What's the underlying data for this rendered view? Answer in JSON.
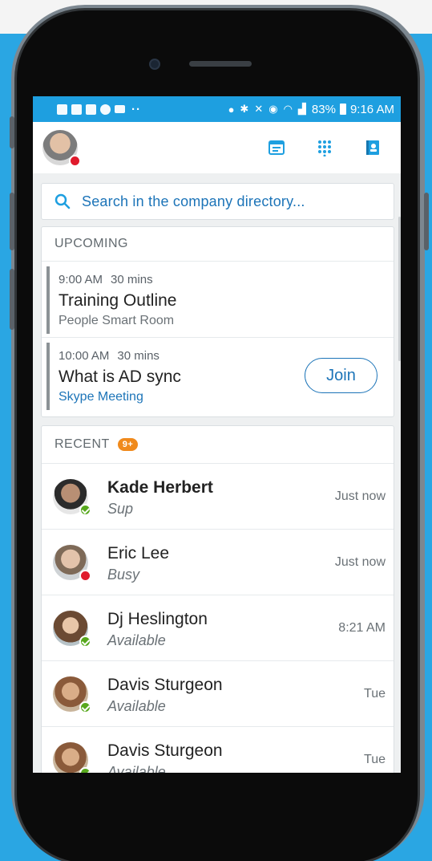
{
  "statusbar": {
    "dots": "··",
    "battery": "83%",
    "time": "9:16 AM"
  },
  "search": {
    "placeholder": "Search in the company directory..."
  },
  "upcoming": {
    "heading": "UPCOMING",
    "events": [
      {
        "time": "9:00 AM",
        "duration": "30 mins",
        "title": "Training Outline",
        "location": "People Smart Room"
      },
      {
        "time": "10:00 AM",
        "duration": "30 mins",
        "title": "What is AD sync",
        "location": "Skype Meeting",
        "join_label": "Join"
      }
    ]
  },
  "recent": {
    "heading": "RECENT",
    "badge": "9+",
    "contacts": [
      {
        "name": "Kade Herbert",
        "status": "Sup",
        "time": "Just now",
        "presence": "available"
      },
      {
        "name": "Eric Lee",
        "status": "Busy",
        "time": "Just now",
        "presence": "busy"
      },
      {
        "name": "Dj Heslington",
        "status": "Available",
        "time": "8:21 AM",
        "presence": "available"
      },
      {
        "name": "Davis Sturgeon",
        "status": "Available",
        "time": "Tue",
        "presence": "available"
      },
      {
        "name": "Davis Sturgeon",
        "status": "Available",
        "time": "Tue",
        "presence": "available"
      }
    ]
  },
  "colors": {
    "accent": "#1e9fe0",
    "link": "#1c74b8",
    "busy": "#e01b2c",
    "available": "#57a81c",
    "badge": "#f08a1c",
    "background": "#2aa6e3"
  }
}
